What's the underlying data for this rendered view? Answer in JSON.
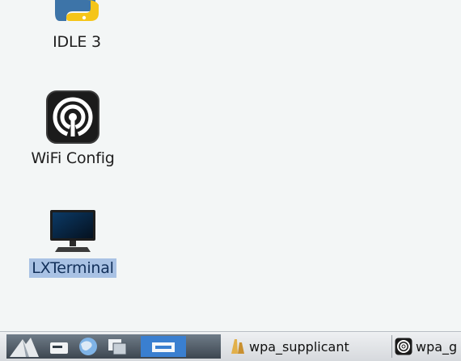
{
  "desktop": {
    "icons": [
      {
        "label": "IDLE 3",
        "icon": "python-icon"
      },
      {
        "label": "WiFi Config",
        "icon": "wifi-icon"
      },
      {
        "label": "LXTerminal",
        "icon": "monitor-icon"
      }
    ],
    "selected_color": "#a9c2e4"
  },
  "taskbar": {
    "launchers": [
      "menu-icon",
      "file-manager-icon",
      "web-browser-icon",
      "windows-icon",
      "show-desktop-icon"
    ],
    "tasks": [
      {
        "label": "wpa_supplicant",
        "icon": "folder-icon"
      },
      {
        "label": "wpa_g",
        "icon": "wifi-icon"
      }
    ]
  }
}
